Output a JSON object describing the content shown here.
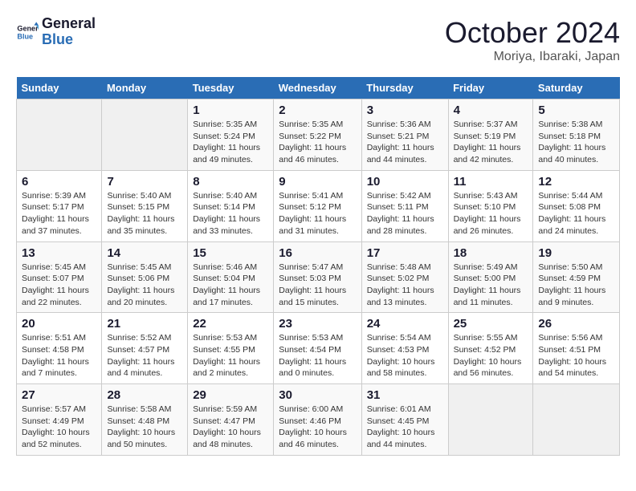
{
  "header": {
    "logo_line1": "General",
    "logo_line2": "Blue",
    "title": "October 2024",
    "subtitle": "Moriya, Ibaraki, Japan"
  },
  "weekdays": [
    "Sunday",
    "Monday",
    "Tuesday",
    "Wednesday",
    "Thursday",
    "Friday",
    "Saturday"
  ],
  "weeks": [
    [
      {
        "day": "",
        "sunrise": "",
        "sunset": "",
        "daylight": ""
      },
      {
        "day": "",
        "sunrise": "",
        "sunset": "",
        "daylight": ""
      },
      {
        "day": "1",
        "sunrise": "Sunrise: 5:35 AM",
        "sunset": "Sunset: 5:24 PM",
        "daylight": "Daylight: 11 hours and 49 minutes."
      },
      {
        "day": "2",
        "sunrise": "Sunrise: 5:35 AM",
        "sunset": "Sunset: 5:22 PM",
        "daylight": "Daylight: 11 hours and 46 minutes."
      },
      {
        "day": "3",
        "sunrise": "Sunrise: 5:36 AM",
        "sunset": "Sunset: 5:21 PM",
        "daylight": "Daylight: 11 hours and 44 minutes."
      },
      {
        "day": "4",
        "sunrise": "Sunrise: 5:37 AM",
        "sunset": "Sunset: 5:19 PM",
        "daylight": "Daylight: 11 hours and 42 minutes."
      },
      {
        "day": "5",
        "sunrise": "Sunrise: 5:38 AM",
        "sunset": "Sunset: 5:18 PM",
        "daylight": "Daylight: 11 hours and 40 minutes."
      }
    ],
    [
      {
        "day": "6",
        "sunrise": "Sunrise: 5:39 AM",
        "sunset": "Sunset: 5:17 PM",
        "daylight": "Daylight: 11 hours and 37 minutes."
      },
      {
        "day": "7",
        "sunrise": "Sunrise: 5:40 AM",
        "sunset": "Sunset: 5:15 PM",
        "daylight": "Daylight: 11 hours and 35 minutes."
      },
      {
        "day": "8",
        "sunrise": "Sunrise: 5:40 AM",
        "sunset": "Sunset: 5:14 PM",
        "daylight": "Daylight: 11 hours and 33 minutes."
      },
      {
        "day": "9",
        "sunrise": "Sunrise: 5:41 AM",
        "sunset": "Sunset: 5:12 PM",
        "daylight": "Daylight: 11 hours and 31 minutes."
      },
      {
        "day": "10",
        "sunrise": "Sunrise: 5:42 AM",
        "sunset": "Sunset: 5:11 PM",
        "daylight": "Daylight: 11 hours and 28 minutes."
      },
      {
        "day": "11",
        "sunrise": "Sunrise: 5:43 AM",
        "sunset": "Sunset: 5:10 PM",
        "daylight": "Daylight: 11 hours and 26 minutes."
      },
      {
        "day": "12",
        "sunrise": "Sunrise: 5:44 AM",
        "sunset": "Sunset: 5:08 PM",
        "daylight": "Daylight: 11 hours and 24 minutes."
      }
    ],
    [
      {
        "day": "13",
        "sunrise": "Sunrise: 5:45 AM",
        "sunset": "Sunset: 5:07 PM",
        "daylight": "Daylight: 11 hours and 22 minutes."
      },
      {
        "day": "14",
        "sunrise": "Sunrise: 5:45 AM",
        "sunset": "Sunset: 5:06 PM",
        "daylight": "Daylight: 11 hours and 20 minutes."
      },
      {
        "day": "15",
        "sunrise": "Sunrise: 5:46 AM",
        "sunset": "Sunset: 5:04 PM",
        "daylight": "Daylight: 11 hours and 17 minutes."
      },
      {
        "day": "16",
        "sunrise": "Sunrise: 5:47 AM",
        "sunset": "Sunset: 5:03 PM",
        "daylight": "Daylight: 11 hours and 15 minutes."
      },
      {
        "day": "17",
        "sunrise": "Sunrise: 5:48 AM",
        "sunset": "Sunset: 5:02 PM",
        "daylight": "Daylight: 11 hours and 13 minutes."
      },
      {
        "day": "18",
        "sunrise": "Sunrise: 5:49 AM",
        "sunset": "Sunset: 5:00 PM",
        "daylight": "Daylight: 11 hours and 11 minutes."
      },
      {
        "day": "19",
        "sunrise": "Sunrise: 5:50 AM",
        "sunset": "Sunset: 4:59 PM",
        "daylight": "Daylight: 11 hours and 9 minutes."
      }
    ],
    [
      {
        "day": "20",
        "sunrise": "Sunrise: 5:51 AM",
        "sunset": "Sunset: 4:58 PM",
        "daylight": "Daylight: 11 hours and 7 minutes."
      },
      {
        "day": "21",
        "sunrise": "Sunrise: 5:52 AM",
        "sunset": "Sunset: 4:57 PM",
        "daylight": "Daylight: 11 hours and 4 minutes."
      },
      {
        "day": "22",
        "sunrise": "Sunrise: 5:53 AM",
        "sunset": "Sunset: 4:55 PM",
        "daylight": "Daylight: 11 hours and 2 minutes."
      },
      {
        "day": "23",
        "sunrise": "Sunrise: 5:53 AM",
        "sunset": "Sunset: 4:54 PM",
        "daylight": "Daylight: 11 hours and 0 minutes."
      },
      {
        "day": "24",
        "sunrise": "Sunrise: 5:54 AM",
        "sunset": "Sunset: 4:53 PM",
        "daylight": "Daylight: 10 hours and 58 minutes."
      },
      {
        "day": "25",
        "sunrise": "Sunrise: 5:55 AM",
        "sunset": "Sunset: 4:52 PM",
        "daylight": "Daylight: 10 hours and 56 minutes."
      },
      {
        "day": "26",
        "sunrise": "Sunrise: 5:56 AM",
        "sunset": "Sunset: 4:51 PM",
        "daylight": "Daylight: 10 hours and 54 minutes."
      }
    ],
    [
      {
        "day": "27",
        "sunrise": "Sunrise: 5:57 AM",
        "sunset": "Sunset: 4:49 PM",
        "daylight": "Daylight: 10 hours and 52 minutes."
      },
      {
        "day": "28",
        "sunrise": "Sunrise: 5:58 AM",
        "sunset": "Sunset: 4:48 PM",
        "daylight": "Daylight: 10 hours and 50 minutes."
      },
      {
        "day": "29",
        "sunrise": "Sunrise: 5:59 AM",
        "sunset": "Sunset: 4:47 PM",
        "daylight": "Daylight: 10 hours and 48 minutes."
      },
      {
        "day": "30",
        "sunrise": "Sunrise: 6:00 AM",
        "sunset": "Sunset: 4:46 PM",
        "daylight": "Daylight: 10 hours and 46 minutes."
      },
      {
        "day": "31",
        "sunrise": "Sunrise: 6:01 AM",
        "sunset": "Sunset: 4:45 PM",
        "daylight": "Daylight: 10 hours and 44 minutes."
      },
      {
        "day": "",
        "sunrise": "",
        "sunset": "",
        "daylight": ""
      },
      {
        "day": "",
        "sunrise": "",
        "sunset": "",
        "daylight": ""
      }
    ]
  ]
}
